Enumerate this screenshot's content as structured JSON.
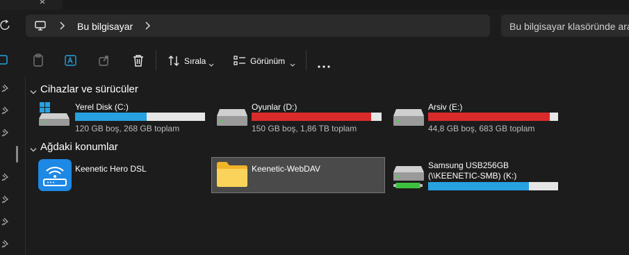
{
  "breadcrumb": {
    "location": "Bu bilgisayar"
  },
  "search": {
    "placeholder": "Bu bilgisayar klasöründe ara"
  },
  "toolbar": {
    "sort_label": "Sırala",
    "view_label": "Görünüm"
  },
  "sections": [
    {
      "title": "Cihazlar ve sürücüler"
    },
    {
      "title": "Ağdaki konumlar"
    }
  ],
  "drives": [
    {
      "name": "Yerel Disk (C:)",
      "info": "120 GB boş, 268 GB toplam",
      "used_fraction": 0.552,
      "color": "#27a1e0"
    },
    {
      "name": "Oyunlar (D:)",
      "info": "150 GB boş, 1,86 TB toplam",
      "used_fraction": 0.92,
      "color": "#da2b2b"
    },
    {
      "name": "Arsiv (E:)",
      "info": "44,8 GB boş, 683 GB toplam",
      "used_fraction": 0.935,
      "color": "#da2b2b"
    }
  ],
  "network": [
    {
      "name": "Keenetic Hero DSL"
    },
    {
      "name": "Keenetic-WebDAV"
    },
    {
      "name_line1": "Samsung USB256GB",
      "name_line2": "(\\\\KEENETIC-SMB) (K:)",
      "used_fraction": 0.775,
      "color": "#27a1e0"
    }
  ],
  "colors": {
    "accent": "#27a1e0",
    "danger": "#da2b2b",
    "background": "#1c1c1c"
  }
}
